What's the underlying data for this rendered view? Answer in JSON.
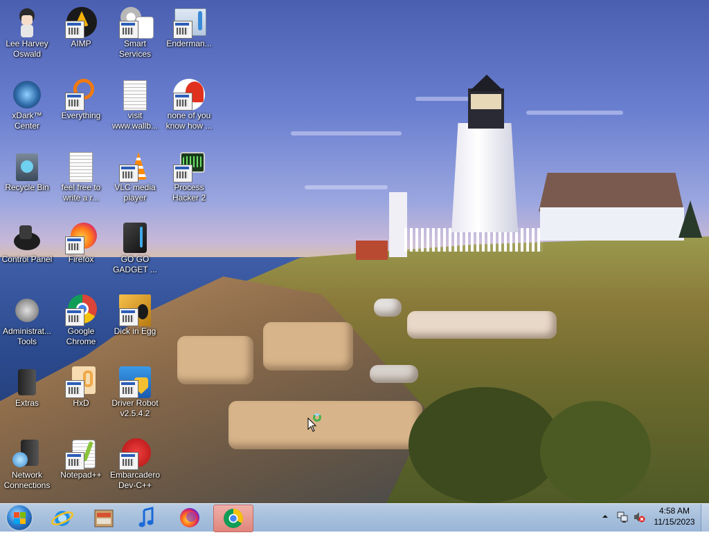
{
  "desktop": {
    "icons": [
      {
        "label": "Lee Harvey Oswald",
        "icon": "anime-avatar-icon"
      },
      {
        "label": "AIMP",
        "icon": "aimp-icon"
      },
      {
        "label": "Smart Services",
        "icon": "gears-icon"
      },
      {
        "label": "Enderman...",
        "icon": "window-icon"
      },
      {
        "label": "xDark™ Center",
        "icon": "orb-icon"
      },
      {
        "label": "Everything",
        "icon": "search-icon"
      },
      {
        "label": "visit www.wallb...",
        "icon": "text-document-icon"
      },
      {
        "label": "none of you know how ...",
        "icon": "red-logo-icon"
      },
      {
        "label": "Recycle Bin",
        "icon": "recycle-bin-icon"
      },
      {
        "label": "feel free to write a r...",
        "icon": "text-document-icon"
      },
      {
        "label": "VLC media player",
        "icon": "vlc-cone-icon"
      },
      {
        "label": "Process Hacker 2",
        "icon": "process-hacker-icon"
      },
      {
        "label": "Control Panel",
        "icon": "control-panel-icon"
      },
      {
        "label": "Firefox",
        "icon": "firefox-icon"
      },
      {
        "label": "GO GO GADGET ...",
        "icon": "black-device-icon"
      },
      {
        "label": "Administrat... Tools",
        "icon": "admin-tools-icon"
      },
      {
        "label": "Google Chrome",
        "icon": "chrome-icon"
      },
      {
        "label": "Dick in Egg",
        "icon": "egg-app-icon"
      },
      {
        "label": "Extras",
        "icon": "extras-icon"
      },
      {
        "label": "HxD",
        "icon": "hxd-icon"
      },
      {
        "label": "Driver Robot v2.5.4.2",
        "icon": "shield-icon"
      },
      {
        "label": "Network Connections",
        "icon": "network-icon"
      },
      {
        "label": "Notepad++",
        "icon": "notepad-icon"
      },
      {
        "label": "Embarcadero Dev-C++",
        "icon": "devcpp-icon"
      }
    ]
  },
  "taskbar": {
    "pinned": [
      {
        "name": "internet-explorer",
        "icon": "internet-explorer-icon"
      },
      {
        "name": "media-center",
        "icon": "media-center-icon"
      },
      {
        "name": "music",
        "icon": "music-note-icon"
      },
      {
        "name": "firefox",
        "icon": "firefox-icon"
      },
      {
        "name": "chrome",
        "icon": "chrome-icon",
        "active": true
      }
    ],
    "tray": {
      "time": "4:58 AM",
      "date": "11/15/2023"
    }
  },
  "colors": {
    "taskbar": "#a6bfdc",
    "active_button": "#e0857c",
    "label_text": "#ffffff"
  }
}
